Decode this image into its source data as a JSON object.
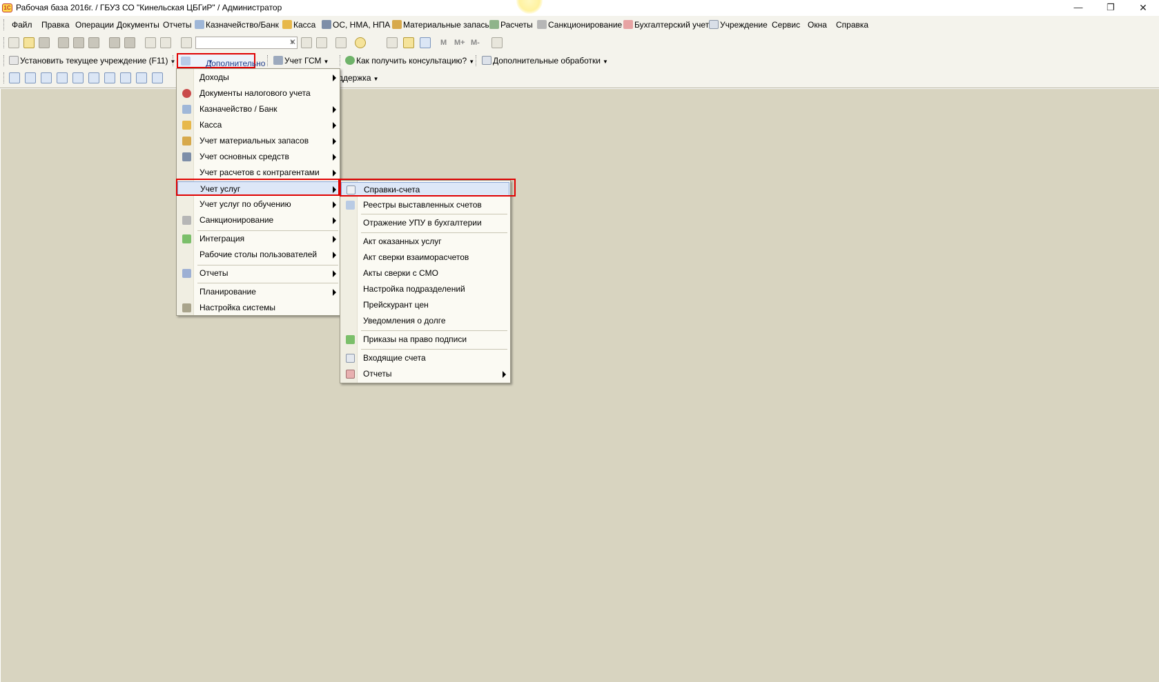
{
  "window": {
    "title": "Рабочая база 2016г. / ГБУЗ СО \"Кинельская ЦБГиР\" / Администратор",
    "logo_text": "1С",
    "minimize": "—",
    "maximize": "❐",
    "close": "✕"
  },
  "menubar": [
    {
      "label": "Файл",
      "icon": null
    },
    {
      "label": "Правка",
      "icon": null
    },
    {
      "label": "Операции",
      "icon": null
    },
    {
      "label": "Документы",
      "icon": null
    },
    {
      "label": "Отчеты",
      "icon": null
    },
    {
      "label": "Казначейство/Банк",
      "icon": "bank-icon"
    },
    {
      "label": "Касса",
      "icon": "coins-icon"
    },
    {
      "label": "ОС, НМА, НПА",
      "icon": "truck-icon"
    },
    {
      "label": "Материальные запасы",
      "icon": "boxes-icon"
    },
    {
      "label": "Расчеты",
      "icon": "calc-icon"
    },
    {
      "label": "Санкционирование",
      "icon": "sigma-icon"
    },
    {
      "label": "Бухгалтерский учет",
      "icon": "dt-kt-icon"
    },
    {
      "label": "Учреждение",
      "icon": "document-icon"
    },
    {
      "label": "Сервис",
      "icon": null
    },
    {
      "label": "Окна",
      "icon": null
    },
    {
      "label": "Справка",
      "icon": null
    }
  ],
  "toolbar": {
    "search_value": "",
    "m_buttons": [
      "M",
      "M+",
      "M-"
    ]
  },
  "toolbar2": {
    "set_institution": "Установить текущее учреждение (F11)",
    "additional": "Дополнительно",
    "fuel": "Учет ГСМ",
    "consultation": "Как получить консультацию?",
    "extra_processing": "Дополнительные обработки"
  },
  "toolbar3": {
    "support": "ддержка"
  },
  "menu_additional": {
    "items": [
      {
        "label": "Доходы",
        "submenu": true
      },
      {
        "label": "Документы налогового учета",
        "submenu": false
      },
      {
        "label": "Казначейство / Банк",
        "submenu": true
      },
      {
        "label": "Касса",
        "submenu": true
      },
      {
        "label": "Учет материальных запасов",
        "submenu": true
      },
      {
        "label": "Учет основных средств",
        "submenu": true
      },
      {
        "label": "Учет расчетов с контрагентами",
        "submenu": true
      },
      {
        "label": "Учет услуг",
        "submenu": true
      },
      {
        "label": "Учет услуг по обучению",
        "submenu": true
      },
      {
        "label": "Санкционирование",
        "submenu": true
      },
      {
        "label": "Интеграция",
        "submenu": true
      },
      {
        "label": "Рабочие столы пользователей",
        "submenu": true
      },
      {
        "label": "Отчеты",
        "submenu": true
      },
      {
        "label": "Планирование",
        "submenu": true
      },
      {
        "label": "Настройка системы",
        "submenu": false
      }
    ]
  },
  "menu_services": {
    "items": [
      {
        "label": "Справки-счета",
        "submenu": false
      },
      {
        "label": "Реестры выставленных счетов",
        "submenu": false
      },
      {
        "label": "Отражение УПУ в бухгалтерии",
        "submenu": false
      },
      {
        "label": "Акт оказанных услуг",
        "submenu": false
      },
      {
        "label": "Акт сверки взаиморасчетов",
        "submenu": false
      },
      {
        "label": "Акты сверки с СМО",
        "submenu": false
      },
      {
        "label": "Настройка подразделений",
        "submenu": false
      },
      {
        "label": "Прейскурант цен",
        "submenu": false
      },
      {
        "label": "Уведомления о долге",
        "submenu": false
      },
      {
        "label": "Приказы на право подписи",
        "submenu": false
      },
      {
        "label": "Входящие счета",
        "submenu": false
      },
      {
        "label": "Отчеты",
        "submenu": true
      }
    ]
  },
  "colors": {
    "highlight_border": "#e00000",
    "workspace": "#d8d4c0",
    "menu_bg": "#fbfaf3"
  }
}
